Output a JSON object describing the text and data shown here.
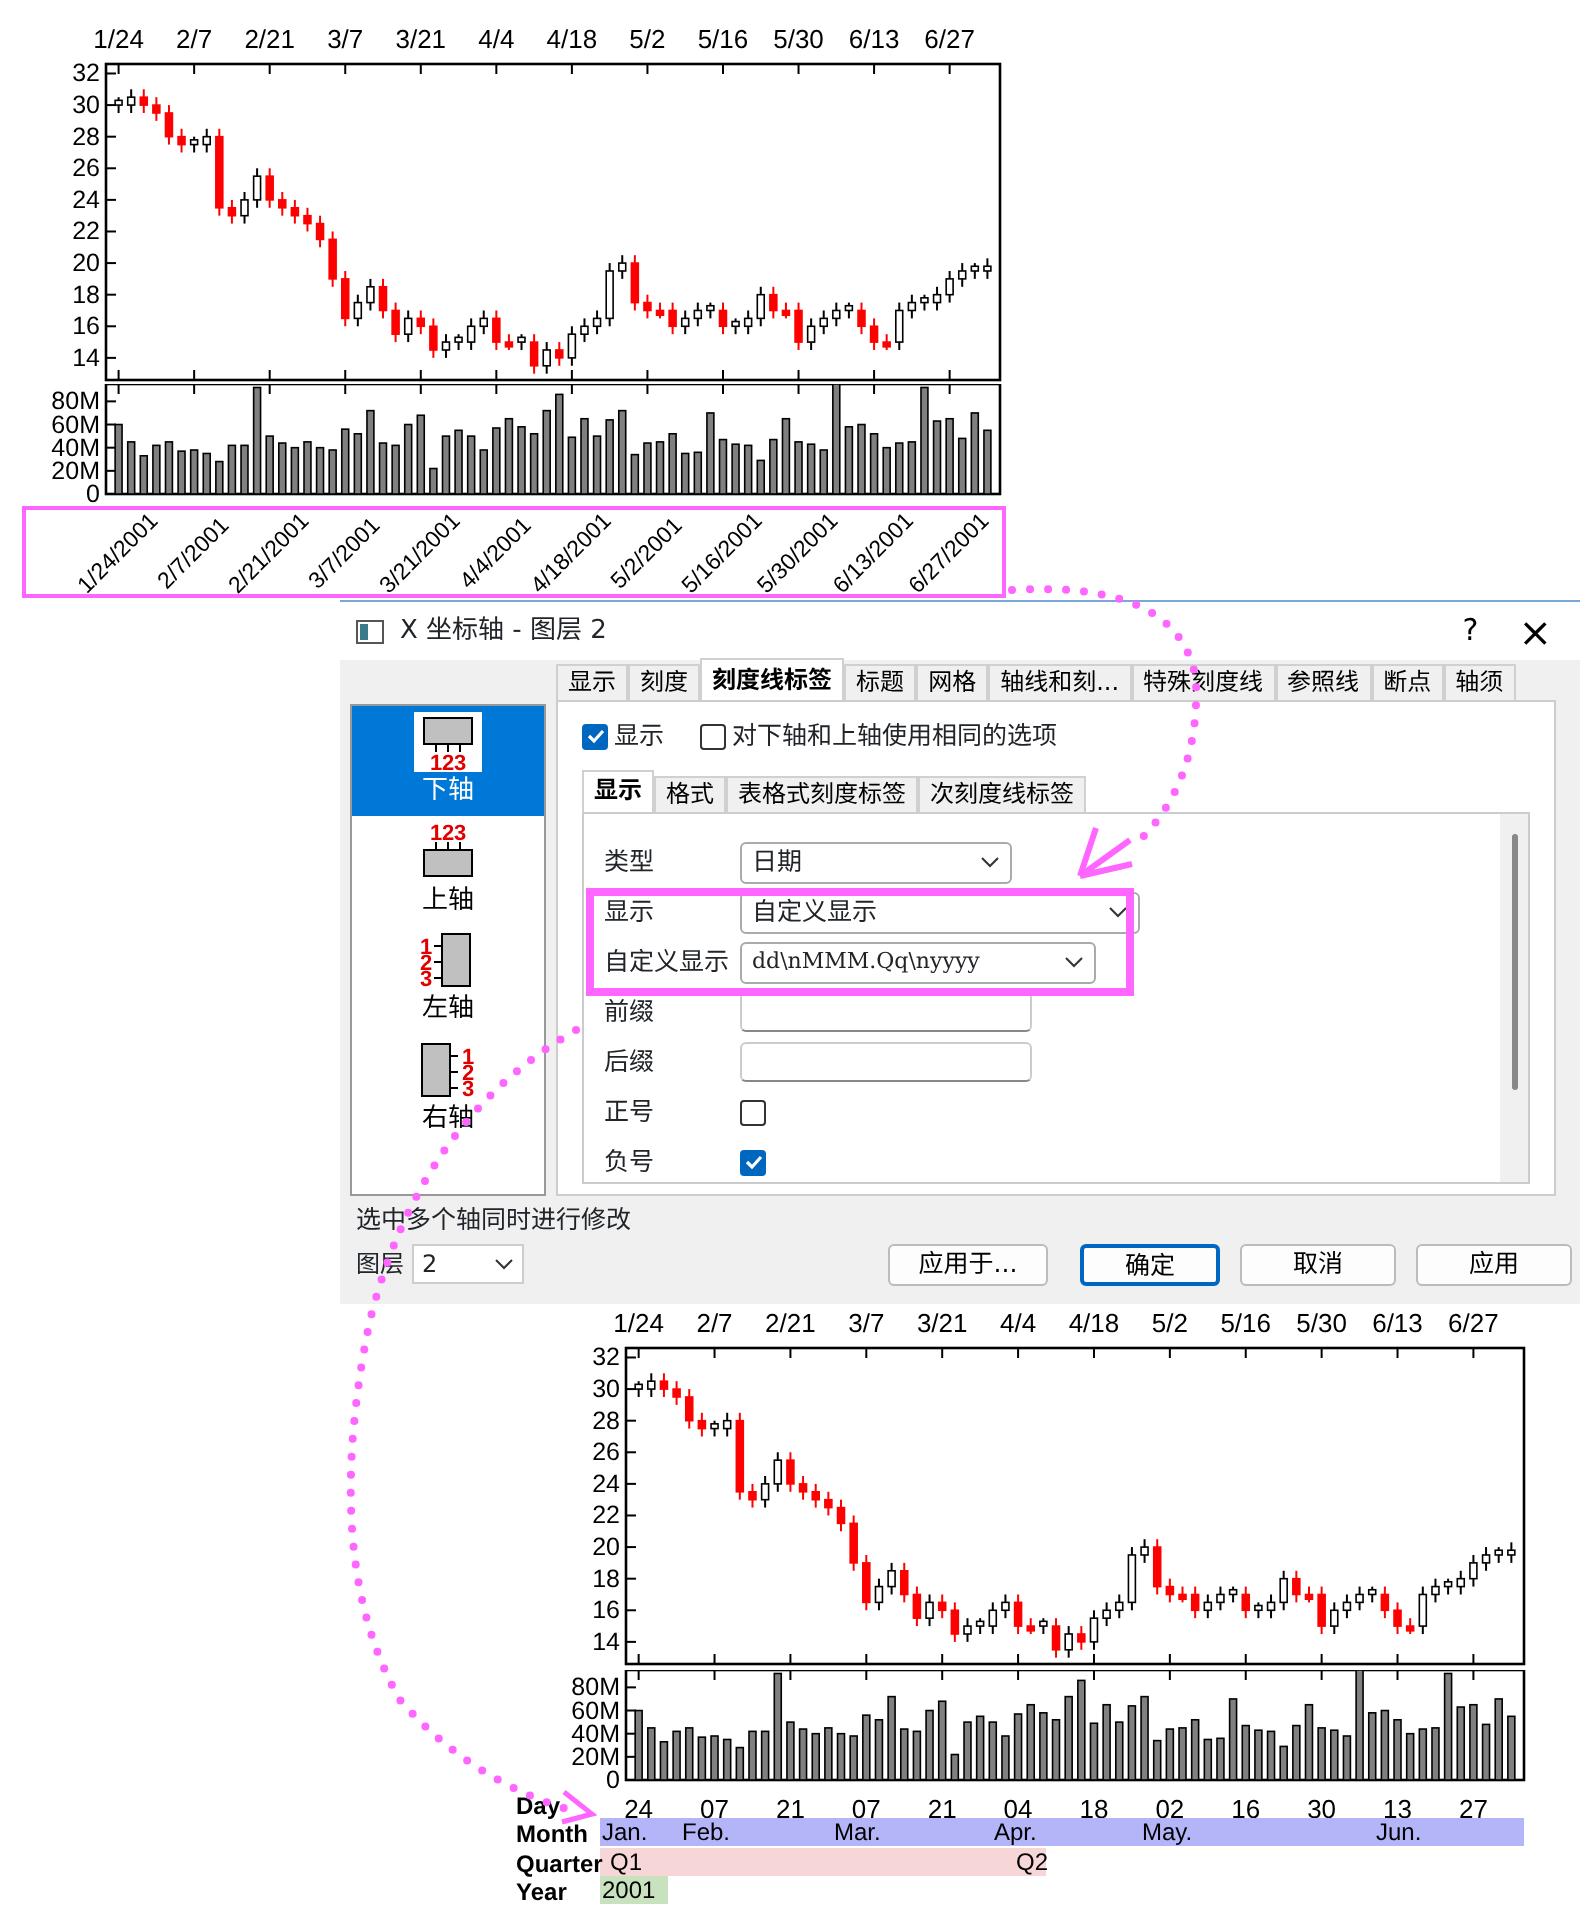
{
  "top_chart": {
    "price_chart": {
      "chart_data": {
        "type": "candlestick",
        "ylim": [
          12.6,
          32.6
        ],
        "yticks": [
          {
            "value": 14,
            "label": "14"
          },
          {
            "value": 16,
            "label": "16"
          },
          {
            "value": 18,
            "label": "18"
          },
          {
            "value": 20,
            "label": "20"
          },
          {
            "value": 22,
            "label": "22"
          },
          {
            "value": 24,
            "label": "24"
          },
          {
            "value": 26,
            "label": "26"
          },
          {
            "value": 28,
            "label": "28"
          },
          {
            "value": 30,
            "label": "30"
          },
          {
            "value": 32,
            "label": "32"
          }
        ],
        "categories": [
          "1/24",
          null,
          null,
          null,
          null,
          null,
          "2/7",
          null,
          null,
          null,
          null,
          null,
          "2/21",
          null,
          null,
          null,
          null,
          null,
          "3/7",
          null,
          null,
          null,
          null,
          null,
          "3/21",
          null,
          null,
          null,
          null,
          null,
          "4/4",
          null,
          null,
          null,
          null,
          null,
          "4/18",
          null,
          null,
          null,
          null,
          null,
          "5/2",
          null,
          null,
          null,
          null,
          null,
          "5/16",
          null,
          null,
          null,
          null,
          null,
          "5/30",
          null,
          null,
          null,
          null,
          null,
          "6/13",
          null,
          null,
          null,
          null,
          null,
          "6/27",
          null,
          null,
          null
        ],
        "ohlc": [
          [
            30,
            30.5,
            29.5,
            30.3
          ],
          [
            30,
            31,
            29.5,
            30.5
          ],
          [
            30.5,
            31,
            29.5,
            30
          ],
          [
            30,
            30.5,
            29,
            29.5
          ],
          [
            29.5,
            30,
            27.5,
            28
          ],
          [
            28,
            28.5,
            27,
            27.5
          ],
          [
            27.5,
            28,
            27,
            27.8
          ],
          [
            27.5,
            28.5,
            27,
            28
          ],
          [
            28,
            28.5,
            23,
            23.5
          ],
          [
            23.5,
            24,
            22.5,
            23
          ],
          [
            23,
            24.5,
            22.5,
            24
          ],
          [
            24,
            26,
            23.5,
            25.5
          ],
          [
            25.5,
            26,
            23.5,
            24
          ],
          [
            24,
            24.5,
            23,
            23.5
          ],
          [
            23.5,
            24,
            22.5,
            23
          ],
          [
            23,
            23.5,
            22,
            22.5
          ],
          [
            22.5,
            23,
            21,
            21.5
          ],
          [
            21.5,
            22,
            18.5,
            19
          ],
          [
            19,
            19.5,
            16,
            16.5
          ],
          [
            16.5,
            18,
            16,
            17.5
          ],
          [
            17.5,
            19,
            17,
            18.5
          ],
          [
            18.5,
            19,
            16.5,
            17
          ],
          [
            17,
            17.5,
            15,
            15.5
          ],
          [
            15.5,
            17,
            15,
            16.5
          ],
          [
            16.5,
            17,
            15.5,
            16
          ],
          [
            16,
            16.5,
            14,
            14.5
          ],
          [
            14.5,
            15.5,
            14,
            15
          ],
          [
            15,
            15.5,
            14.5,
            15.3
          ],
          [
            15,
            16.5,
            14.5,
            16
          ],
          [
            16,
            17,
            15.5,
            16.5
          ],
          [
            16.5,
            17,
            14.5,
            15
          ],
          [
            15,
            15.5,
            14.5,
            14.7
          ],
          [
            15,
            15.5,
            14.5,
            15.3
          ],
          [
            15,
            15.5,
            13,
            13.5
          ],
          [
            13.5,
            15,
            13,
            14.5
          ],
          [
            14.5,
            15,
            13.5,
            14
          ],
          [
            14,
            16,
            13.5,
            15.5
          ],
          [
            15.5,
            16.5,
            15,
            16
          ],
          [
            16,
            17,
            15.5,
            16.5
          ],
          [
            16.5,
            20,
            16,
            19.5
          ],
          [
            19.5,
            20.5,
            19,
            20
          ],
          [
            20,
            20.5,
            17,
            17.5
          ],
          [
            17.5,
            18,
            16.5,
            17
          ],
          [
            17,
            17.5,
            16.5,
            16.7
          ],
          [
            17,
            17.5,
            15.5,
            16
          ],
          [
            16,
            17,
            15.5,
            16.5
          ],
          [
            16.5,
            17.5,
            16,
            17
          ],
          [
            17,
            17.5,
            16.5,
            17.3
          ],
          [
            17,
            17.5,
            15.5,
            16
          ],
          [
            16,
            16.5,
            15.5,
            16.3
          ],
          [
            16,
            17,
            15.5,
            16.5
          ],
          [
            16.5,
            18.5,
            16,
            18
          ],
          [
            18,
            18.5,
            16.5,
            17
          ],
          [
            17,
            17.5,
            16.5,
            16.7
          ],
          [
            17,
            17.5,
            14.5,
            15
          ],
          [
            15,
            16.5,
            14.5,
            16
          ],
          [
            16,
            17,
            15.5,
            16.5
          ],
          [
            16.5,
            17.5,
            16,
            17
          ],
          [
            17,
            17.5,
            16.5,
            17.3
          ],
          [
            17,
            17.5,
            15.5,
            16
          ],
          [
            16,
            16.5,
            14.5,
            15
          ],
          [
            15,
            15.5,
            14.5,
            14.7
          ],
          [
            15,
            17.5,
            14.5,
            17
          ],
          [
            17,
            18,
            16.5,
            17.5
          ],
          [
            17.5,
            18,
            17,
            17.8
          ],
          [
            17.5,
            18.5,
            17,
            18
          ],
          [
            18,
            19.5,
            17.5,
            19
          ],
          [
            19,
            20,
            18.5,
            19.5
          ],
          [
            19.5,
            20,
            19,
            19.8
          ],
          [
            19.5,
            20.3,
            19,
            19.8
          ]
        ]
      }
    },
    "volume_chart": {
      "chart_data": {
        "type": "bar",
        "ylim": [
          0,
          95
        ],
        "yticks": [
          {
            "value": 0,
            "label": "0"
          },
          {
            "value": 20,
            "label": "20M"
          },
          {
            "value": 40,
            "label": "40M"
          },
          {
            "value": 60,
            "label": "60M"
          },
          {
            "value": 80,
            "label": "80M"
          }
        ],
        "categories": [
          "1/24/2001",
          null,
          null,
          null,
          null,
          null,
          "2/7/2001",
          null,
          null,
          null,
          null,
          null,
          "2/21/2001",
          null,
          null,
          null,
          null,
          null,
          "3/7/2001",
          null,
          null,
          null,
          null,
          null,
          "3/21/2001",
          null,
          null,
          null,
          null,
          null,
          "4/4/2001",
          null,
          null,
          null,
          null,
          null,
          "4/18/2001",
          null,
          null,
          null,
          null,
          null,
          "5/2/2001",
          null,
          null,
          null,
          null,
          null,
          "5/16/2001",
          null,
          null,
          null,
          null,
          null,
          "5/30/2001",
          null,
          null,
          null,
          null,
          null,
          "6/13/2001",
          null,
          null,
          null,
          null,
          null,
          "6/27/2001",
          null,
          null,
          null
        ],
        "values": [
          60,
          45,
          33,
          42,
          45,
          37,
          38,
          35,
          28,
          42,
          42,
          92,
          50,
          44,
          40,
          45,
          40,
          38,
          56,
          52,
          72,
          44,
          42,
          60,
          68,
          22,
          50,
          55,
          50,
          38,
          57,
          65,
          58,
          52,
          72,
          86,
          49,
          65,
          50,
          64,
          72,
          34,
          44,
          45,
          52,
          35,
          36,
          70,
          47,
          43,
          42,
          29,
          47,
          65,
          45,
          43,
          38,
          95,
          58,
          60,
          52,
          40,
          44,
          45,
          92,
          63,
          65,
          48,
          70,
          55
        ]
      }
    }
  },
  "dialog": {
    "title": "X 坐标轴 - 图层 2",
    "help": "?",
    "close": "×",
    "axes": [
      {
        "label": "下轴",
        "selected": true,
        "icon_text": [
          "1",
          "2",
          "3"
        ]
      },
      {
        "label": "上轴",
        "selected": false,
        "icon_text": [
          "1",
          "2",
          "3"
        ]
      },
      {
        "label": "左轴",
        "selected": false,
        "icon_text": [
          "1",
          "2",
          "3"
        ]
      },
      {
        "label": "右轴",
        "selected": false,
        "icon_text": [
          "1",
          "2",
          "3"
        ]
      }
    ],
    "tabs": [
      {
        "label": "显示",
        "selected": false
      },
      {
        "label": "刻度",
        "selected": false
      },
      {
        "label": "刻度线标签",
        "selected": true
      },
      {
        "label": "标题",
        "selected": false
      },
      {
        "label": "网格",
        "selected": false
      },
      {
        "label": "轴线和刻...",
        "selected": false
      },
      {
        "label": "特殊刻度线",
        "selected": false
      },
      {
        "label": "参照线",
        "selected": false
      },
      {
        "label": "断点",
        "selected": false
      },
      {
        "label": "轴须",
        "selected": false
      }
    ],
    "options": [
      {
        "label": "显示",
        "checked": true
      },
      {
        "label": "对下轴和上轴使用相同的选项",
        "checked": false
      }
    ],
    "subtabs": [
      {
        "label": "显示",
        "selected": true
      },
      {
        "label": "格式",
        "selected": false
      },
      {
        "label": "表格式刻度标签",
        "selected": false
      },
      {
        "label": "次刻度线标签",
        "selected": false
      }
    ],
    "fields": [
      {
        "kind": "select",
        "label": "类型",
        "value": "日期"
      },
      {
        "kind": "select",
        "label": "显示",
        "value": "自定义显示"
      },
      {
        "kind": "combo",
        "label": "自定义显示",
        "value": "dd\\nMMM.Qq\\nyyyy"
      },
      {
        "kind": "text",
        "label": "前缀"
      },
      {
        "kind": "text",
        "label": "后缀"
      },
      {
        "kind": "checkbox",
        "label": "正号",
        "checked": false
      },
      {
        "kind": "checkbox",
        "label": "负号",
        "checked": true
      }
    ],
    "hint": "选中多个轴同时进行修改",
    "layer": {
      "label": "图层",
      "value": "2"
    },
    "buttons": [
      {
        "label": "应用于...",
        "default": false
      },
      {
        "label": "确定",
        "default": true
      },
      {
        "label": "取消",
        "default": false
      },
      {
        "label": "应用",
        "default": false
      }
    ]
  },
  "bottom_chart": {
    "price_chart": {
      "chart_data": {
        "type": "candlestick",
        "ylim": [
          12.6,
          32.6
        ],
        "yticks": [
          {
            "value": 14,
            "label": "14"
          },
          {
            "value": 16,
            "label": "16"
          },
          {
            "value": 18,
            "label": "18"
          },
          {
            "value": 20,
            "label": "20"
          },
          {
            "value": 22,
            "label": "22"
          },
          {
            "value": 24,
            "label": "24"
          },
          {
            "value": 26,
            "label": "26"
          },
          {
            "value": 28,
            "label": "28"
          },
          {
            "value": 30,
            "label": "30"
          },
          {
            "value": 32,
            "label": "32"
          }
        ],
        "categories": [
          "1/24",
          null,
          null,
          null,
          null,
          null,
          "2/7",
          null,
          null,
          null,
          null,
          null,
          "2/21",
          null,
          null,
          null,
          null,
          null,
          "3/7",
          null,
          null,
          null,
          null,
          null,
          "3/21",
          null,
          null,
          null,
          null,
          null,
          "4/4",
          null,
          null,
          null,
          null,
          null,
          "4/18",
          null,
          null,
          null,
          null,
          null,
          "5/2",
          null,
          null,
          null,
          null,
          null,
          "5/16",
          null,
          null,
          null,
          null,
          null,
          "5/30",
          null,
          null,
          null,
          null,
          null,
          "6/13",
          null,
          null,
          null,
          null,
          null,
          "6/27",
          null,
          null,
          null
        ],
        "ohlc": [
          [
            30,
            30.5,
            29.5,
            30.3
          ],
          [
            30,
            31,
            29.5,
            30.5
          ],
          [
            30.5,
            31,
            29.5,
            30
          ],
          [
            30,
            30.5,
            29,
            29.5
          ],
          [
            29.5,
            30,
            27.5,
            28
          ],
          [
            28,
            28.5,
            27,
            27.5
          ],
          [
            27.5,
            28,
            27,
            27.8
          ],
          [
            27.5,
            28.5,
            27,
            28
          ],
          [
            28,
            28.5,
            23,
            23.5
          ],
          [
            23.5,
            24,
            22.5,
            23
          ],
          [
            23,
            24.5,
            22.5,
            24
          ],
          [
            24,
            26,
            23.5,
            25.5
          ],
          [
            25.5,
            26,
            23.5,
            24
          ],
          [
            24,
            24.5,
            23,
            23.5
          ],
          [
            23.5,
            24,
            22.5,
            23
          ],
          [
            23,
            23.5,
            22,
            22.5
          ],
          [
            22.5,
            23,
            21,
            21.5
          ],
          [
            21.5,
            22,
            18.5,
            19
          ],
          [
            19,
            19.5,
            16,
            16.5
          ],
          [
            16.5,
            18,
            16,
            17.5
          ],
          [
            17.5,
            19,
            17,
            18.5
          ],
          [
            18.5,
            19,
            16.5,
            17
          ],
          [
            17,
            17.5,
            15,
            15.5
          ],
          [
            15.5,
            17,
            15,
            16.5
          ],
          [
            16.5,
            17,
            15.5,
            16
          ],
          [
            16,
            16.5,
            14,
            14.5
          ],
          [
            14.5,
            15.5,
            14,
            15
          ],
          [
            15,
            15.5,
            14.5,
            15.3
          ],
          [
            15,
            16.5,
            14.5,
            16
          ],
          [
            16,
            17,
            15.5,
            16.5
          ],
          [
            16.5,
            17,
            14.5,
            15
          ],
          [
            15,
            15.5,
            14.5,
            14.7
          ],
          [
            15,
            15.5,
            14.5,
            15.3
          ],
          [
            15,
            15.5,
            13,
            13.5
          ],
          [
            13.5,
            15,
            13,
            14.5
          ],
          [
            14.5,
            15,
            13.5,
            14
          ],
          [
            14,
            16,
            13.5,
            15.5
          ],
          [
            15.5,
            16.5,
            15,
            16
          ],
          [
            16,
            17,
            15.5,
            16.5
          ],
          [
            16.5,
            20,
            16,
            19.5
          ],
          [
            19.5,
            20.5,
            19,
            20
          ],
          [
            20,
            20.5,
            17,
            17.5
          ],
          [
            17.5,
            18,
            16.5,
            17
          ],
          [
            17,
            17.5,
            16.5,
            16.7
          ],
          [
            17,
            17.5,
            15.5,
            16
          ],
          [
            16,
            17,
            15.5,
            16.5
          ],
          [
            16.5,
            17.5,
            16,
            17
          ],
          [
            17,
            17.5,
            16.5,
            17.3
          ],
          [
            17,
            17.5,
            15.5,
            16
          ],
          [
            16,
            16.5,
            15.5,
            16.3
          ],
          [
            16,
            17,
            15.5,
            16.5
          ],
          [
            16.5,
            18.5,
            16,
            18
          ],
          [
            18,
            18.5,
            16.5,
            17
          ],
          [
            17,
            17.5,
            16.5,
            16.7
          ],
          [
            17,
            17.5,
            14.5,
            15
          ],
          [
            15,
            16.5,
            14.5,
            16
          ],
          [
            16,
            17,
            15.5,
            16.5
          ],
          [
            16.5,
            17.5,
            16,
            17
          ],
          [
            17,
            17.5,
            16.5,
            17.3
          ],
          [
            17,
            17.5,
            15.5,
            16
          ],
          [
            16,
            16.5,
            14.5,
            15
          ],
          [
            15,
            15.5,
            14.5,
            14.7
          ],
          [
            15,
            17.5,
            14.5,
            17
          ],
          [
            17,
            18,
            16.5,
            17.5
          ],
          [
            17.5,
            18,
            17,
            17.8
          ],
          [
            17.5,
            18.5,
            17,
            18
          ],
          [
            18,
            19.5,
            17.5,
            19
          ],
          [
            19,
            20,
            18.5,
            19.5
          ],
          [
            19.5,
            20,
            19,
            19.8
          ],
          [
            19.5,
            20.3,
            19,
            19.8
          ]
        ]
      }
    },
    "volume_chart": {
      "chart_data": {
        "type": "bar",
        "ylim": [
          0,
          95
        ],
        "yticks": [
          {
            "value": 0,
            "label": "0"
          },
          {
            "value": 20,
            "label": "20M"
          },
          {
            "value": 40,
            "label": "40M"
          },
          {
            "value": 60,
            "label": "60M"
          },
          {
            "value": 80,
            "label": "80M"
          }
        ],
        "categories": [
          "24",
          null,
          null,
          null,
          null,
          null,
          "07",
          null,
          null,
          null,
          null,
          null,
          "21",
          null,
          null,
          null,
          null,
          null,
          "07",
          null,
          null,
          null,
          null,
          null,
          "21",
          null,
          null,
          null,
          null,
          null,
          "04",
          null,
          null,
          null,
          null,
          null,
          "18",
          null,
          null,
          null,
          null,
          null,
          "02",
          null,
          null,
          null,
          null,
          null,
          "16",
          null,
          null,
          null,
          null,
          null,
          "30",
          null,
          null,
          null,
          null,
          null,
          "13",
          null,
          null,
          null,
          null,
          null,
          "27",
          null,
          null,
          null
        ],
        "values": [
          60,
          45,
          33,
          42,
          45,
          37,
          38,
          35,
          28,
          42,
          42,
          92,
          50,
          44,
          40,
          45,
          40,
          38,
          56,
          52,
          72,
          44,
          42,
          60,
          68,
          22,
          50,
          55,
          50,
          38,
          57,
          65,
          58,
          52,
          72,
          86,
          49,
          65,
          50,
          64,
          72,
          34,
          44,
          45,
          52,
          35,
          36,
          70,
          47,
          43,
          42,
          29,
          47,
          65,
          45,
          43,
          38,
          95,
          58,
          60,
          52,
          40,
          44,
          45,
          92,
          63,
          65,
          48,
          70,
          55
        ]
      }
    },
    "axis_rows": [
      {
        "label": "Day"
      },
      {
        "label": "Month",
        "color": "#b4b4f8",
        "items": [
          "Jan.",
          "Feb.",
          "Mar.",
          "Apr.",
          "May.",
          "Jun."
        ]
      },
      {
        "label": "Quarter",
        "color": "#f6d6d6",
        "items": [
          "Q1",
          "Q2"
        ]
      },
      {
        "label": "Year",
        "color": "#c8e2c0",
        "items": [
          "2001"
        ]
      }
    ]
  }
}
